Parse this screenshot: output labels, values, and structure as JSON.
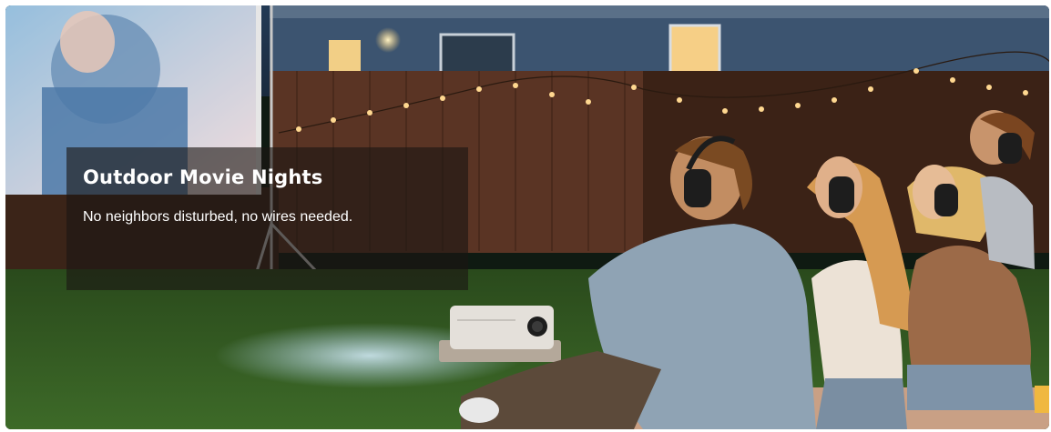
{
  "banner": {
    "title": "Outdoor Movie Nights",
    "subtitle": "No neighbors disturbed, no wires needed."
  },
  "colors": {
    "panel_overlay": "#1c1614",
    "title_text": "#ffffff",
    "grass": "#2f5a22",
    "fence": "#5a3424",
    "house_wall": "#3c5470",
    "string_light": "#ffd890"
  }
}
